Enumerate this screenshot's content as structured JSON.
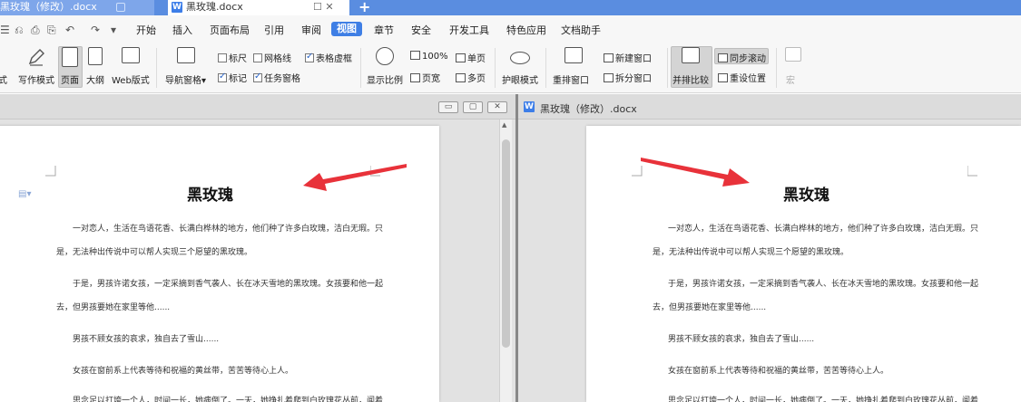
{
  "tabs": [
    {
      "label": "黑玫瑰（修改）.docx",
      "active": false
    },
    {
      "label": "黑玫瑰.docx",
      "active": true
    }
  ],
  "tab_add": "+",
  "tab_controls": "☐ ✕",
  "menu": {
    "quick_access": [
      "☰",
      "⎌",
      "⎙",
      "⎘",
      "↶",
      "↷",
      "▾"
    ],
    "items": [
      "开始",
      "插入",
      "页面布局",
      "引用",
      "审阅",
      "视图",
      "章节",
      "安全",
      "开发工具",
      "特色应用",
      "文档助手"
    ],
    "active": "视图"
  },
  "ribbon": {
    "full_mode": "式",
    "write_mode": "写作模式",
    "page_view": "页面",
    "outline": "大纲",
    "web_layout": "Web版式",
    "nav_pane": "导航窗格",
    "nav_pane_arrow": "▾",
    "ruler": "标尺",
    "gridlines": "网格线",
    "table_gridlines": "表格虚框",
    "marks": "标记",
    "task_pane": "任务窗格",
    "zoom": "显示比例",
    "zoom_100": "100%",
    "single_page": "单页",
    "page_width": "页宽",
    "multi_page": "多页",
    "eye_mode": "护眼模式",
    "arrange_window": "重排窗口",
    "new_window": "新建窗口",
    "split_window": "拆分窗口",
    "side_by_side": "并排比较",
    "sync_scroll": "同步滚动",
    "reset_position": "重设位置",
    "more": "宏",
    "checked": {
      "ruler": false,
      "gridlines": false,
      "table_gridlines": true,
      "marks": true,
      "task_pane": true
    }
  },
  "left_window": {
    "controls": [
      "▭",
      "▢",
      "✕"
    ]
  },
  "right_window": {
    "title": "黑玫瑰（修改）.docx"
  },
  "document": {
    "title": "黑玫瑰",
    "lines": [
      "一对恋人，生活在鸟语花香、长满白桦林的地方，他们种了许多白玫瑰，洁白无瑕。只",
      "是，无法种出传说中可以帮人实现三个愿望的黑玫瑰。",
      "于是，男孩许诺女孩，一定采摘到香气袭人、长在冰天雪地的黑玫瑰。女孩要和他一起",
      "去，但男孩要她在家里等他......",
      "男孩不顾女孩的哀求，独自去了雪山......",
      "女孩在窗前系上代表等待和祝福的黄丝带，苦苦等待心上人。",
      "思念足以打垮一个人，时间一长，她病倒了。一天，她挣扎着爬到白玫瑰花丛前，闻着"
    ]
  },
  "colors": {
    "tabbar": "#5a8de0",
    "accent": "#3f7fe5",
    "arrow": "#e8323a"
  }
}
